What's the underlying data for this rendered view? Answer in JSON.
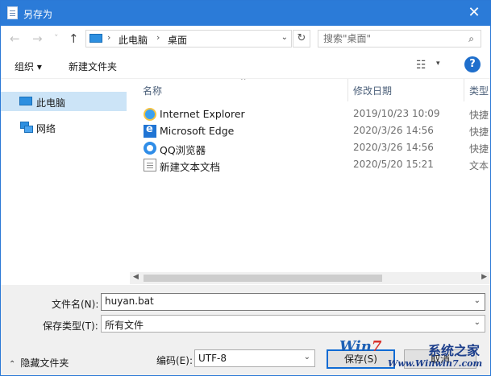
{
  "titlebar": {
    "title": "另存为",
    "close_glyph": "✕"
  },
  "address": {
    "back_glyph": "←",
    "forward_glyph": "→",
    "recent_glyph": "˅",
    "up_glyph": "↑",
    "crumbs": [
      "此电脑",
      "桌面"
    ],
    "sep_glyph": "›",
    "dropdown_glyph": "⌄",
    "refresh_glyph": "↻",
    "search_placeholder": "搜索\"桌面\"",
    "search_glyph": "⌕"
  },
  "toolbar": {
    "organize": "组织 ▾",
    "new_folder": "新建文件夹",
    "view_glyph": "☷",
    "view_dd_glyph": "▾",
    "help": "?"
  },
  "sidebar": {
    "items": [
      {
        "label": "此电脑",
        "selected": true
      },
      {
        "label": "网络",
        "selected": false
      }
    ]
  },
  "filelist": {
    "columns": {
      "name": "名称",
      "date": "修改日期",
      "type": "类型"
    },
    "sort_glyph": "^",
    "rows": [
      {
        "name": "Internet Explorer",
        "date": "2019/10/23 10:09",
        "type": "快捷",
        "icon": "ie-icon"
      },
      {
        "name": "Microsoft Edge",
        "date": "2020/3/26 14:56",
        "type": "快捷",
        "icon": "edge-icon"
      },
      {
        "name": "QQ浏览器",
        "date": "2020/3/26 14:56",
        "type": "快捷",
        "icon": "qq-icon"
      },
      {
        "name": "新建文本文档",
        "date": "2020/5/20 15:21",
        "type": "文本",
        "icon": "text-document-icon"
      }
    ]
  },
  "scrollbar": {
    "left_glyph": "◀",
    "right_glyph": "▶"
  },
  "form": {
    "filename_label": "文件名(N):",
    "filename_value": "huyan.bat",
    "filetype_label": "保存类型(T):",
    "filetype_value": "所有文件",
    "encoding_label": "编码(E):",
    "encoding_value": "UTF-8",
    "dropdown_glyph": "⌄"
  },
  "footer": {
    "hide_folders": "隐藏文件夹",
    "hide_caret": "⌃",
    "save_label": "保存(S)",
    "cancel_label": "取消"
  },
  "watermark": {
    "logo_prefix": "Win",
    "logo_seven": "7",
    "logo_cn": "系统之家",
    "url": "Www.Winwin7.com"
  }
}
